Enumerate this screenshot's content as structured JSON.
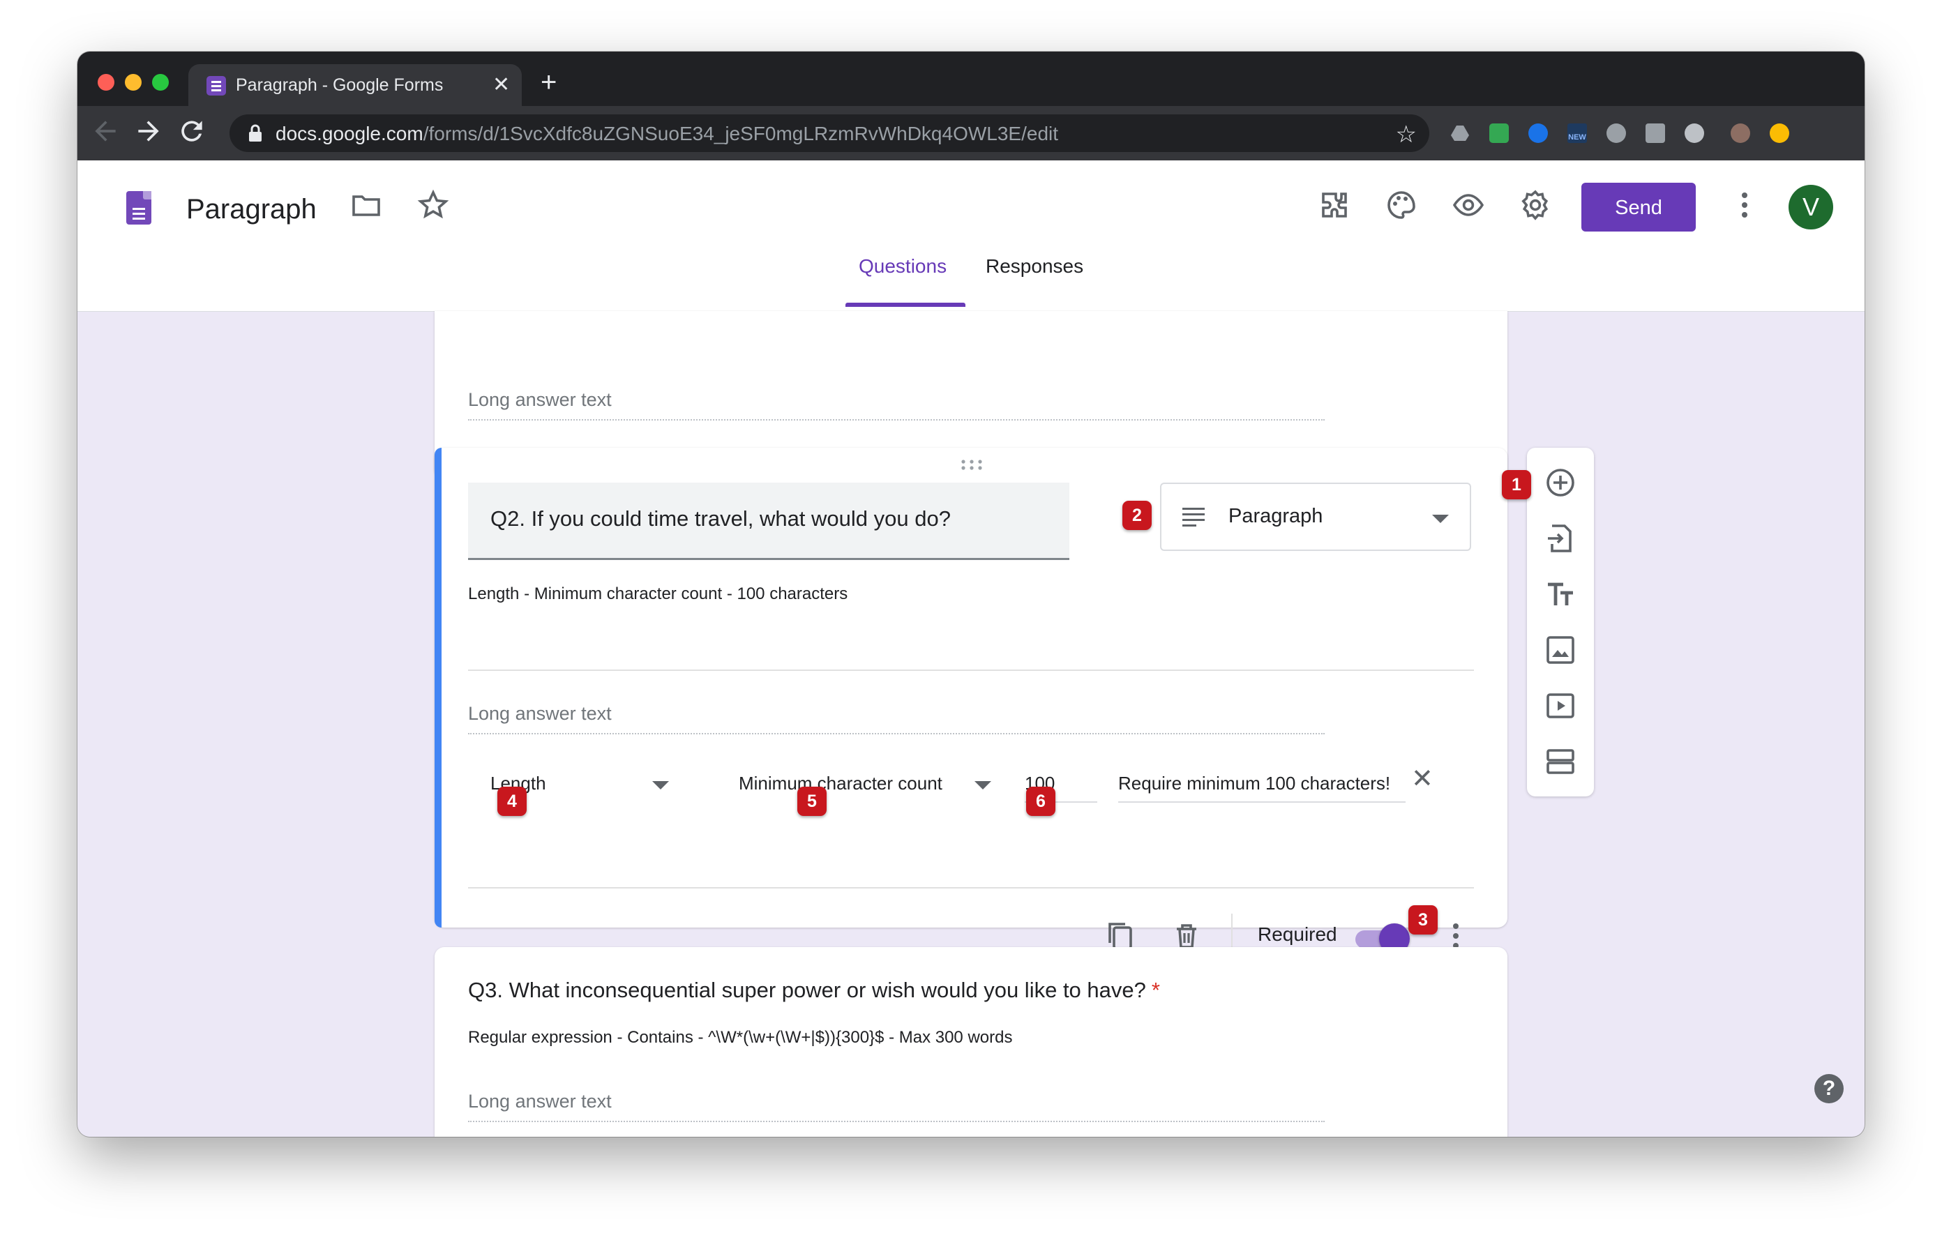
{
  "browser": {
    "tab_title": "Paragraph - Google Forms",
    "tab_close": "✕",
    "new_tab": "+",
    "url_host": "docs.google.com",
    "url_path": "/forms/d/1SvcXdfc8uZGNSuoE34_jeSF0mgLRzmRvWhDkq4OWL3E/edit",
    "extension_new_label": "NEW"
  },
  "header": {
    "doc_title": "Paragraph",
    "send_label": "Send",
    "avatar_initial": "V",
    "tabs": [
      "Questions",
      "Responses"
    ],
    "accent_color": "#673ab7"
  },
  "card1": {
    "long_answer_placeholder": "Long answer text"
  },
  "question2": {
    "title": "Q2.  If you could time travel, what would you do?",
    "type": "Paragraph",
    "validation_description": "Length - Minimum character count - 100 characters",
    "long_answer_placeholder": "Long answer text",
    "validation": {
      "rule_type": "Length",
      "condition": "Minimum character count",
      "value": "100",
      "error_text": "Require minimum 100 characters!"
    },
    "required_label": "Required",
    "required": true
  },
  "question3": {
    "title": "Q3. What inconsequential super power or wish would you like to have?",
    "required_marker": "*",
    "validation_description": "Regular expression - Contains - ^\\W*(\\w+(\\W+|$)){300}$ - Max 300 words",
    "long_answer_placeholder": "Long answer text"
  },
  "callouts": [
    "1",
    "2",
    "3",
    "4",
    "5",
    "6"
  ],
  "help_label": "?"
}
